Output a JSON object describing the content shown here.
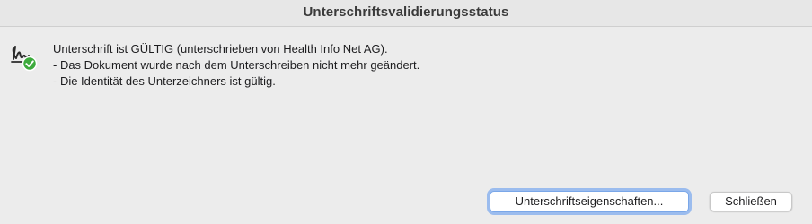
{
  "dialog": {
    "title": "Unterschriftsvalidierungsstatus"
  },
  "status": {
    "icon": "signature-valid-icon",
    "lines": [
      "Unterschrift ist GÜLTIG (unterschrieben von Health Info Net AG).",
      "- Das Dokument wurde nach dem Unterschreiben nicht mehr geändert.",
      "- Die Identität des Unterzeichners ist gültig."
    ]
  },
  "buttons": {
    "properties_label": "Unterschriftseigenschaften...",
    "close_label": "Schließen"
  },
  "colors": {
    "background": "#ececec",
    "valid_check": "#3dab3d",
    "focus_ring": "#5a96f0"
  }
}
